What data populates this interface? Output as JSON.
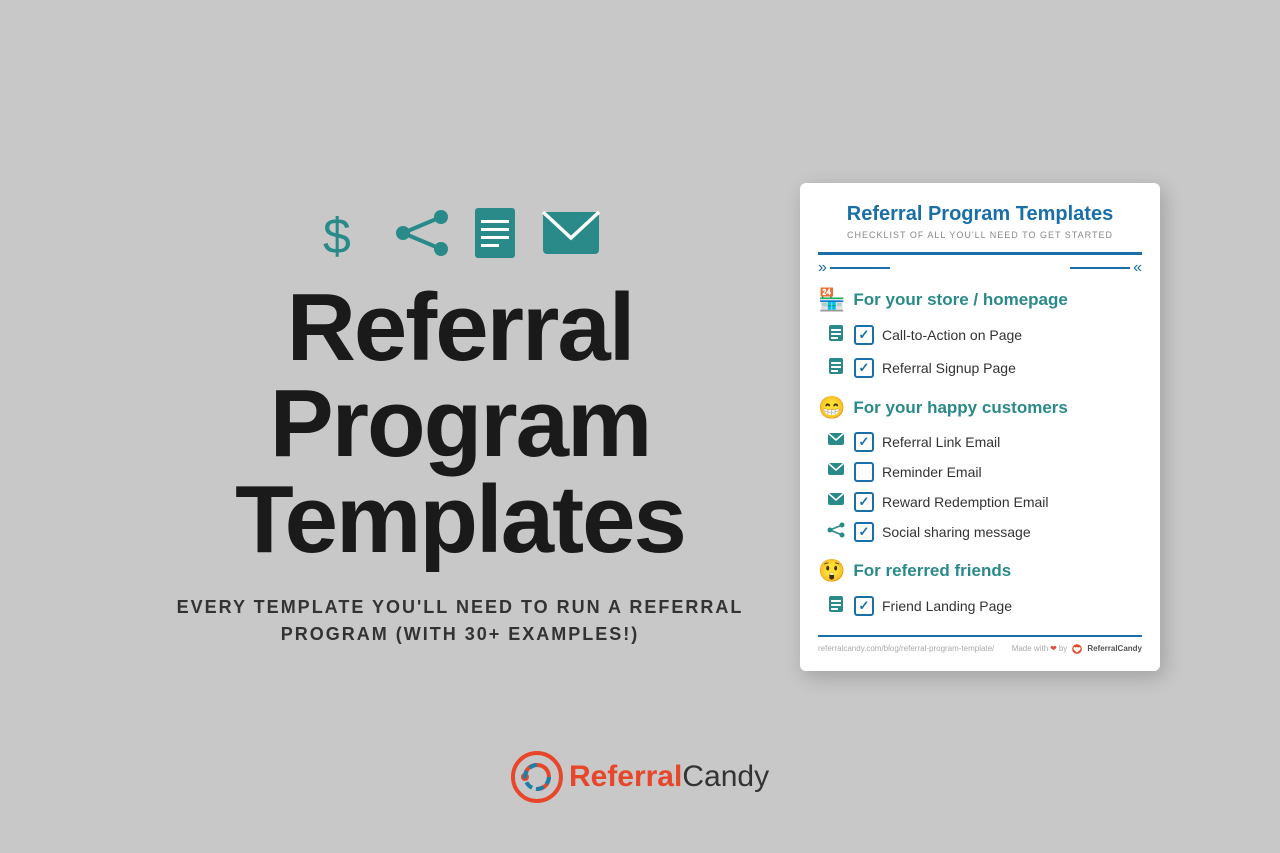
{
  "page": {
    "background_color": "#c8c8c8"
  },
  "left": {
    "icons": [
      "dollar-icon",
      "share-icon",
      "document-icon",
      "email-icon"
    ],
    "title_line1": "Referral",
    "title_line2": "Program",
    "title_line3": "Templates",
    "subtitle": "EVERY TEMPLATE YOU'LL NEED TO RUN A REFERRAL PROGRAM (WITH 30+ EXAMPLES!)"
  },
  "card": {
    "title": "Referral Program Templates",
    "subtitle": "CHECKLIST OF ALL YOU'LL NEED TO GET STARTED",
    "section1": {
      "emoji": "🏪",
      "label": "For your store / homepage",
      "items": [
        {
          "icon": "📄",
          "text": "Call-to-Action on Page",
          "checked": true
        },
        {
          "icon": "📄",
          "text": "Referral Signup Page",
          "checked": true
        }
      ]
    },
    "section2": {
      "emoji": "😁",
      "label": "For your happy customers",
      "items": [
        {
          "icon": "✉",
          "text": "Referral Link Email",
          "checked": true
        },
        {
          "icon": "✉",
          "text": "Reminder Email",
          "checked": false
        },
        {
          "icon": "✉",
          "text": "Reward Redemption Email",
          "checked": true
        },
        {
          "icon": "⋯",
          "text": "Social sharing message",
          "checked": true
        }
      ]
    },
    "section3": {
      "emoji": "😲",
      "label": "For referred friends",
      "items": [
        {
          "icon": "📄",
          "text": "Friend Landing Page",
          "checked": true
        }
      ]
    },
    "footer_url": "referralcandy.com/blog/referral-program-template/",
    "footer_credit": "Made with ❤ by ReferralCandy"
  },
  "logo": {
    "text_plain": "Referral",
    "text_bold": "Candy"
  }
}
